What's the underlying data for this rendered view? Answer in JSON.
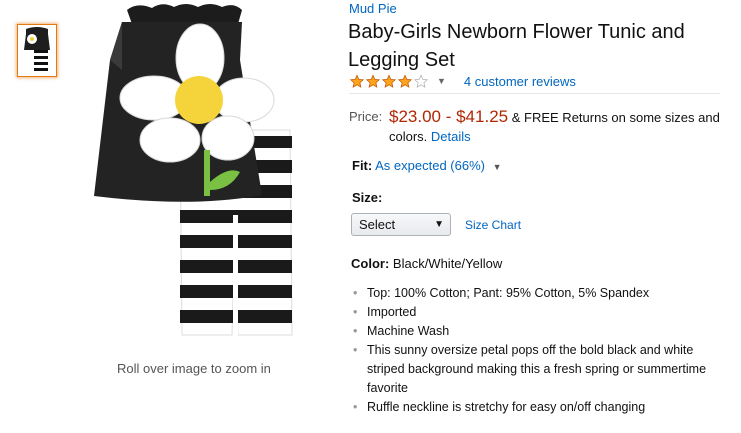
{
  "gallery": {
    "zoom_hint": "Roll over image to zoom in",
    "thumbnail_icon": "product-thumbnail",
    "main_image_icon": "flower-tunic-legging-set-image"
  },
  "product": {
    "brand": "Mud Pie",
    "title": "Baby-Girls Newborn Flower Tunic and Legging Set",
    "rating": {
      "stars": 4,
      "max_stars": 5,
      "reviews_label": "4 customer reviews"
    },
    "price": {
      "label": "Price:",
      "range": "$23.00 - $41.25",
      "free_returns": "& FREE Returns on some sizes and colors.",
      "details_link": "Details"
    },
    "fit": {
      "label": "Fit:",
      "value": "As expected (66%)"
    },
    "size": {
      "label": "Size:",
      "select_value": "Select",
      "size_chart_link": "Size Chart"
    },
    "color": {
      "label": "Color:",
      "value": "Black/White/Yellow"
    },
    "bullets": [
      "Top: 100% Cotton; Pant: 95% Cotton, 5% Spandex",
      "Imported",
      "Machine Wash",
      "This sunny oversize petal pops off the bold black and white striped background making this a fresh spring or summertime favorite",
      "Ruffle neckline is stretchy for easy on/off changing"
    ]
  },
  "colors": {
    "link": "#0066c0",
    "price": "#b12704",
    "star": "#ffa41c",
    "thumb_border": "#e47911"
  }
}
